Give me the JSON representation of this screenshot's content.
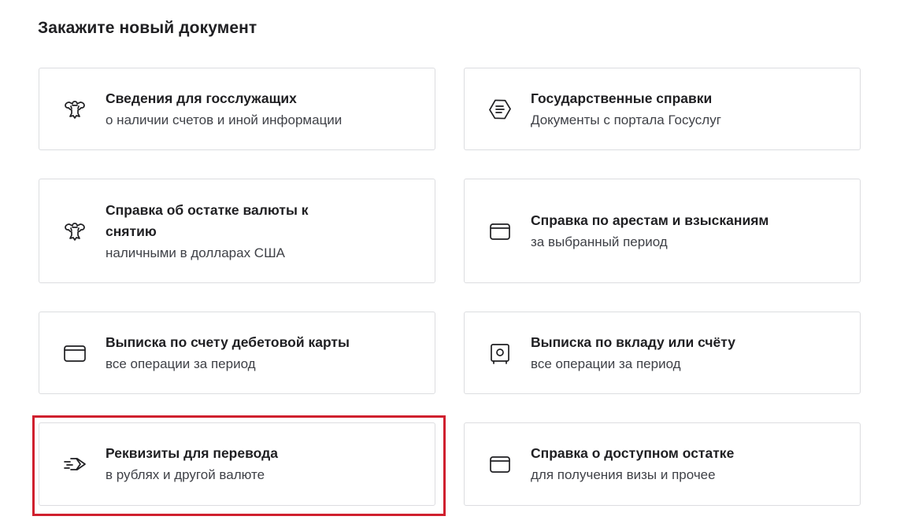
{
  "page": {
    "heading": "Закажите новый документ"
  },
  "cards": [
    {
      "icon": "emblem-icon",
      "title": "Сведения для госслужащих",
      "subtitle": "о наличии счетов и иной информации"
    },
    {
      "icon": "gosuslugi-icon",
      "title": "Государственные справки",
      "subtitle": "Документы с портала Госуслуг"
    },
    {
      "icon": "emblem-icon",
      "title": "Справка об остатке валюты к снятию",
      "subtitle": "наличными в долларах США"
    },
    {
      "icon": "wallet-icon",
      "title": "Справка по арестам и взысканиям",
      "subtitle": "за выбранный период"
    },
    {
      "icon": "card-icon",
      "title": "Выписка по счету дебетовой карты",
      "subtitle": "все операции за период"
    },
    {
      "icon": "safe-icon",
      "title": "Выписка по вкладу или счёту",
      "subtitle": "все операции за период"
    },
    {
      "icon": "transfer-arrow-icon",
      "title": "Реквизиты для перевода",
      "subtitle": "в рублях и другой валюте"
    },
    {
      "icon": "wallet-icon",
      "title": "Справка о доступном остатке",
      "subtitle": "для получения визы и прочее"
    }
  ],
  "highlight": {
    "target": "Реквизиты для перевода",
    "color": "#d0202e"
  }
}
